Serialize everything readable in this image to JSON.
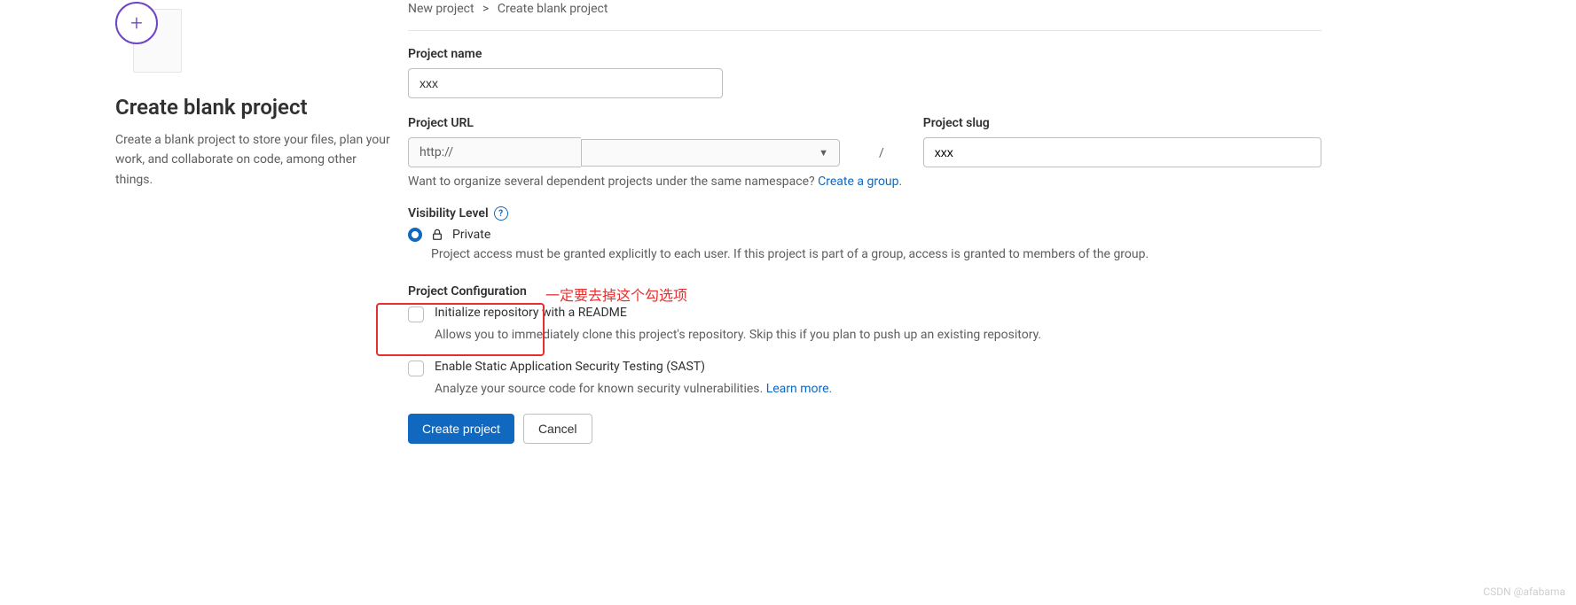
{
  "sidebar": {
    "title": "Create blank project",
    "description": "Create a blank project to store your files, plan your work, and collaborate on code, among other things."
  },
  "breadcrumb": {
    "parent": "New project",
    "current": "Create blank project",
    "separator": ">"
  },
  "form": {
    "name_label": "Project name",
    "name_value": "xxx",
    "url_label": "Project URL",
    "url_prefix": "http://",
    "url_select_value": "",
    "slash": "/",
    "slug_label": "Project slug",
    "slug_value": "xxx",
    "namespace_text": "Want to organize several dependent projects under the same namespace? ",
    "namespace_link": "Create a group",
    "namespace_period": "."
  },
  "visibility": {
    "label": "Visibility Level",
    "option": "Private",
    "description": "Project access must be granted explicitly to each user. If this project is part of a group, access is granted to members of the group."
  },
  "config": {
    "label": "Project Configuration",
    "readme_label": "Initialize repository with a README",
    "readme_desc": "Allows you to immediately clone this project's repository. Skip this if you plan to push up an existing repository.",
    "sast_label": "Enable Static Application Security Testing (SAST)",
    "sast_desc": "Analyze your source code for known security vulnerabilities. ",
    "sast_link": "Learn more.",
    "annotation": "一定要去掉这个勾选项"
  },
  "buttons": {
    "create": "Create project",
    "cancel": "Cancel"
  },
  "watermark": "CSDN @afabama"
}
